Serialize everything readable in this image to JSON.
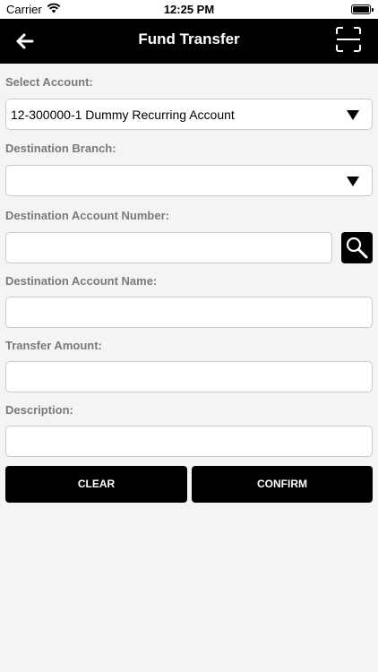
{
  "status_bar": {
    "carrier": "Carrier",
    "time": "12:25 PM"
  },
  "nav": {
    "title": "Fund Transfer",
    "back_icon": "back-arrow-icon",
    "scan_icon": "qr-scan-icon"
  },
  "form": {
    "select_account": {
      "label": "Select Account:",
      "value": "12-300000-1 Dummy Recurring Account"
    },
    "destination_branch": {
      "label": "Destination Branch:",
      "value": ""
    },
    "destination_account_number": {
      "label": "Destination Account Number:",
      "value": ""
    },
    "destination_account_name": {
      "label": "Destination Account Name:",
      "value": ""
    },
    "transfer_amount": {
      "label": "Transfer Amount:",
      "value": ""
    },
    "description": {
      "label": "Description:",
      "value": ""
    }
  },
  "actions": {
    "clear_label": "CLEAR",
    "confirm_label": "CONFIRM"
  },
  "colors": {
    "nav_bg": "#000000",
    "page_bg": "#f4f4f4",
    "button_bg": "#000000",
    "label": "#7a7a7a"
  }
}
